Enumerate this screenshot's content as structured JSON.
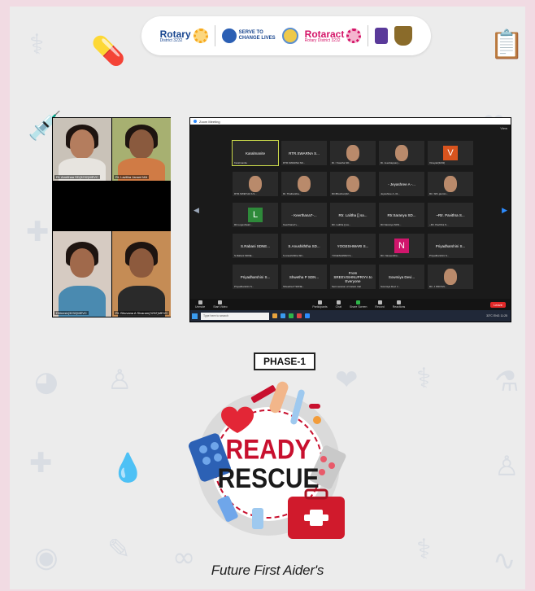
{
  "logos": {
    "rotary_name": "Rotary",
    "rotary_district": "District 3232",
    "serve_text_line1": "SERVE TO",
    "serve_text_line2": "CHANGE LIVES",
    "rotaract_name": "Rotaract",
    "rotaract_district": "Rotary District 3232"
  },
  "video_grid": {
    "tiles": [
      {
        "name": "Rt. Amrithaa SD(3232)MEVC"
      },
      {
        "name": "Rt. Lavitha Janani MA"
      },
      {
        "name": "Dhinesh(3232)MEVC"
      },
      {
        "name": "Rt. Bhuvana A Sivaram(3232)MEVC"
      }
    ]
  },
  "zoom": {
    "window_title": "Zoom Meeting",
    "view_label": "View",
    "tiles": [
      {
        "label": "Karalmanite",
        "tag": "Karalmanite"
      },
      {
        "label": "RTR.SWARNA S...",
        "tag": "RTR.SWARNA SD..."
      },
      {
        "label": "",
        "tag": "Rt. I Swetha SD..."
      },
      {
        "label": "",
        "tag": "Rt. Jeeshappary..."
      },
      {
        "label": "V",
        "tag": "Vinayak(3232)"
      },
      {
        "label": "",
        "tag": "RTR.SWETHA S.S..."
      },
      {
        "label": "",
        "tag": "Rt. Thaibantha..."
      },
      {
        "label": "",
        "tag": "Rtr.Bhushan(32..."
      },
      {
        "label": "- Jeyashree A -...",
        "tag": "Jeyashree A -31..."
      },
      {
        "label": "",
        "tag": "Rtr. SPL.jasmin..."
      },
      {
        "label": "L",
        "tag": "Rtr.Logeshwari..."
      },
      {
        "label": "- Keerthana7-...",
        "tag": "Keerthana7+..."
      },
      {
        "label": "Rtr. Lalitha [] sa...",
        "tag": "Rtr. Lalitha [] sa..."
      },
      {
        "label": "Rtr.Saranya SD...",
        "tag": "Rtr.Saranya SDN..."
      },
      {
        "label": "~Rtr. Pavithra S...",
        "tag": "~Rtr. Pavithra S..."
      },
      {
        "label": "S.Rabani SDNE...",
        "tag": "S.Rabani SDNE..."
      },
      {
        "label": "S.Anushiththa SD...",
        "tag": "S.Anushiththa SD..."
      },
      {
        "label": "YOGESHWARI S...",
        "tag": "YOGESHWARI S..."
      },
      {
        "label": "N",
        "tag": "Rtr. Naveenitha..."
      },
      {
        "label": "Priyadharshini S...",
        "tag": "Priyadharshini S..."
      },
      {
        "label": "Priyadharshini S...",
        "tag": "Priyadharshini S..."
      },
      {
        "label": "Shwetha P SDN...",
        "tag": "Shwetha P SDNE..."
      },
      {
        "label": "From SREEVISHNUPRIYA to Everyone",
        "tag": "Sent session of instant trial"
      },
      {
        "label": "Sowmiya Devi...",
        "tag": "Sowmiya Devi J..."
      },
      {
        "label": "",
        "tag": "Rtr. J PRIYAN..."
      }
    ],
    "toolbar": {
      "unmute": "Unmute",
      "start_video": "Start Video",
      "participants": "Participants",
      "chat": "Chat",
      "share_screen": "Share Screen",
      "record": "Record",
      "reactions": "Reactions",
      "leave": "Leave"
    },
    "taskbar": {
      "search_placeholder": "Type here to search",
      "tray_text": "33°C  ENG  11:25"
    }
  },
  "phase": "PHASE-1",
  "logo_title_line1": "READY",
  "logo_title_line2": "RESCUE",
  "tagline": "Future First Aider's",
  "colors": {
    "background": "#ececec",
    "frame": "#f1dbe3",
    "rescue_red": "#c8102e",
    "zoom_bg": "#1a1a1a"
  }
}
